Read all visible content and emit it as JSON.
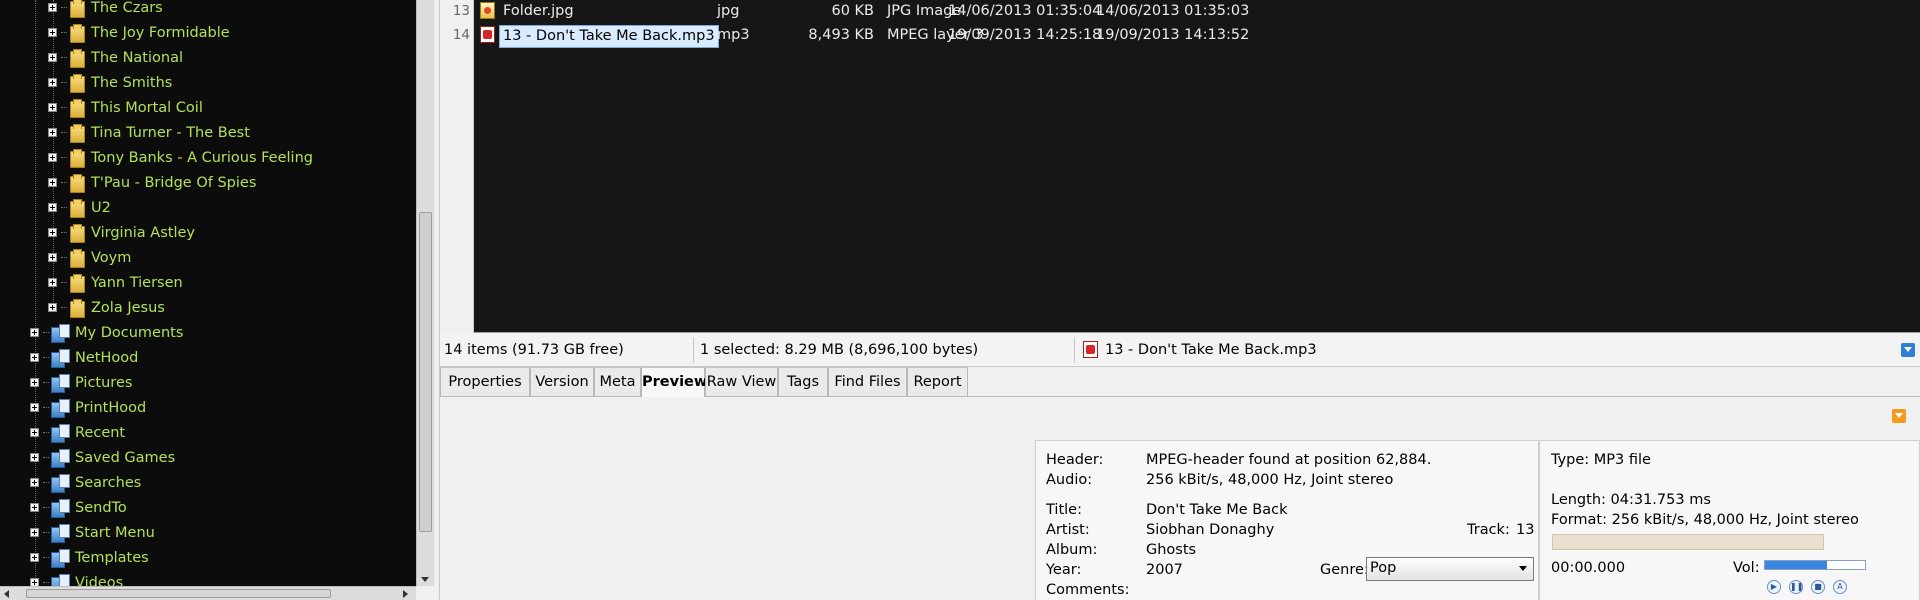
{
  "tree": {
    "subfolders": [
      {
        "label": "The Czars"
      },
      {
        "label": "The Joy Formidable"
      },
      {
        "label": "The National"
      },
      {
        "label": "The Smiths"
      },
      {
        "label": "This Mortal Coil"
      },
      {
        "label": "Tina Turner - The Best"
      },
      {
        "label": "Tony Banks - A Curious Feeling"
      },
      {
        "label": "T'Pau - Bridge Of Spies"
      },
      {
        "label": "U2"
      },
      {
        "label": "Virginia Astley"
      },
      {
        "label": "Voym"
      },
      {
        "label": "Yann Tiersen"
      },
      {
        "label": "Zola Jesus"
      }
    ],
    "folders": [
      {
        "label": "My Documents"
      },
      {
        "label": "NetHood"
      },
      {
        "label": "Pictures"
      },
      {
        "label": "PrintHood"
      },
      {
        "label": "Recent"
      },
      {
        "label": "Saved Games"
      },
      {
        "label": "Searches"
      },
      {
        "label": "SendTo"
      },
      {
        "label": "Start Menu"
      },
      {
        "label": "Templates"
      },
      {
        "label": "Videos"
      }
    ],
    "text_color": "#b3e05a"
  },
  "files": [
    {
      "num": "13",
      "name": "Folder.jpg",
      "ext": "jpg",
      "size": "60 KB",
      "type": "JPG Image",
      "modified": "14/06/2013 01:35:04",
      "created": "14/06/2013 01:35:03",
      "icon": "jpg-file-icon"
    },
    {
      "num": "14",
      "name": "13 - Don't Take Me Back.mp3",
      "ext": "mp3",
      "size": "8,493 KB",
      "type": "MPEG layer 3",
      "modified": "19/09/2013 14:25:18",
      "created": "19/09/2013 14:13:52",
      "icon": "mp3-file-icon",
      "selected": true
    }
  ],
  "status": {
    "items": "14 items (91.73 GB free)",
    "selected": "1 selected: 8.29 MB (8,696,100 bytes)",
    "current_file": "13 - Don't Take Me Back.mp3"
  },
  "tabs": [
    {
      "label": "Properties"
    },
    {
      "label": "Version"
    },
    {
      "label": "Meta"
    },
    {
      "label": "Preview",
      "active": true
    },
    {
      "label": "Raw View"
    },
    {
      "label": "Tags"
    },
    {
      "label": "Find Files"
    },
    {
      "label": "Report"
    }
  ],
  "meta": {
    "header_label": "Header:",
    "header_value": "MPEG-header found at position 62,884.",
    "audio_label": "Audio:",
    "audio_value": "256 kBit/s, 48,000 Hz, Joint stereo",
    "title_label": "Title:",
    "title_value": "Don't Take Me Back",
    "artist_label": "Artist:",
    "artist_value": "Siobhan Donaghy",
    "track_label": "Track:",
    "track_value": "13",
    "album_label": "Album:",
    "album_value": "Ghosts",
    "year_label": "Year:",
    "year_value": "2007",
    "genre_label": "Genre:",
    "genre_value": "Pop",
    "comments_label": "Comments:"
  },
  "player": {
    "type": "Type: MP3 file",
    "length": "Length: 04:31.753 ms",
    "format": "Format: 256 kBit/s, 48,000 Hz, Joint stereo",
    "position": "00:00.000",
    "progress_fraction": 0,
    "vol_label": "Vol:",
    "volume_fraction": 0.62,
    "controls": [
      "play-icon",
      "pause-icon",
      "stop-icon",
      "repeat-icon"
    ]
  },
  "colors": {
    "accent_orange": "#f39a1e",
    "accent_blue": "#2f7fd8"
  }
}
